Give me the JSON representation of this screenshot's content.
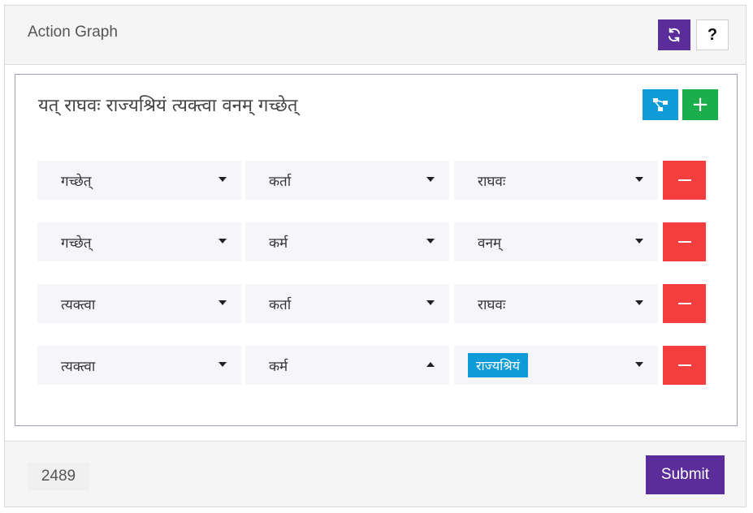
{
  "header": {
    "title": "Action Graph",
    "refresh_icon": "refresh-icon",
    "help_label": "?"
  },
  "sentence": "यत् राघवः राज्यश्रियं त्यक्त्वा वनम् गच्छेत्",
  "toolbar": {
    "graph_icon": "graph-icon",
    "add_label": "+"
  },
  "rows": [
    {
      "source": "गच्छेत्",
      "relation": "कर्ता",
      "target": "राघवः"
    },
    {
      "source": "गच्छेत्",
      "relation": "कर्म",
      "target": "वनम्"
    },
    {
      "source": "त्यक्त्वा",
      "relation": "कर्ता",
      "target": "राघवः"
    },
    {
      "source": "त्यक्त्वा",
      "relation": "कर्म",
      "target": "राज्यश्रियं"
    }
  ],
  "footer": {
    "count": "2489",
    "submit_label": "Submit"
  },
  "colors": {
    "primary": "#5b2d9a",
    "info": "#0f9bd7",
    "success": "#1aaf4b",
    "danger": "#f43d3d"
  }
}
